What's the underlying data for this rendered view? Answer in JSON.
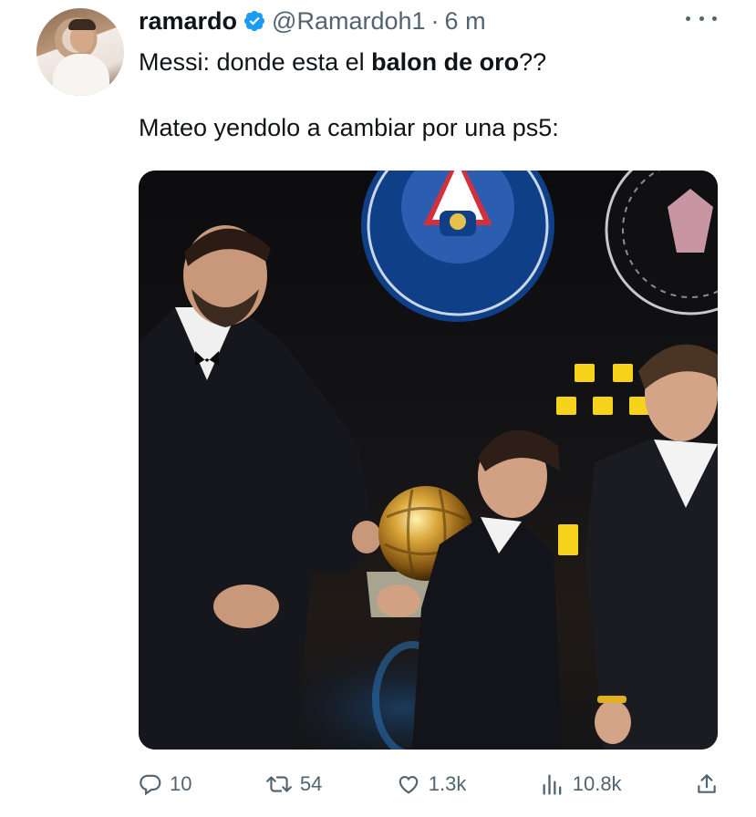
{
  "author": {
    "name": "ramardo",
    "handle": "@Ramardoh1",
    "separator": "·",
    "time": "6 m"
  },
  "tweet": {
    "line1_before": "Messi: donde esta el ",
    "line1_bold": "balon de oro",
    "line1_after": "??",
    "line2": "Mateo yendolo a cambiar por una ps5:"
  },
  "actions": {
    "replies": "10",
    "retweets": "54",
    "likes": "1.3k",
    "views": "10.8k"
  },
  "colors": {
    "verified": "#1d9bf0",
    "muted": "#536471",
    "text": "#0f1419"
  },
  "icons": [
    "more-icon",
    "verified-badge-icon",
    "reply-icon",
    "retweet-icon",
    "like-icon",
    "views-icon",
    "share-icon"
  ]
}
